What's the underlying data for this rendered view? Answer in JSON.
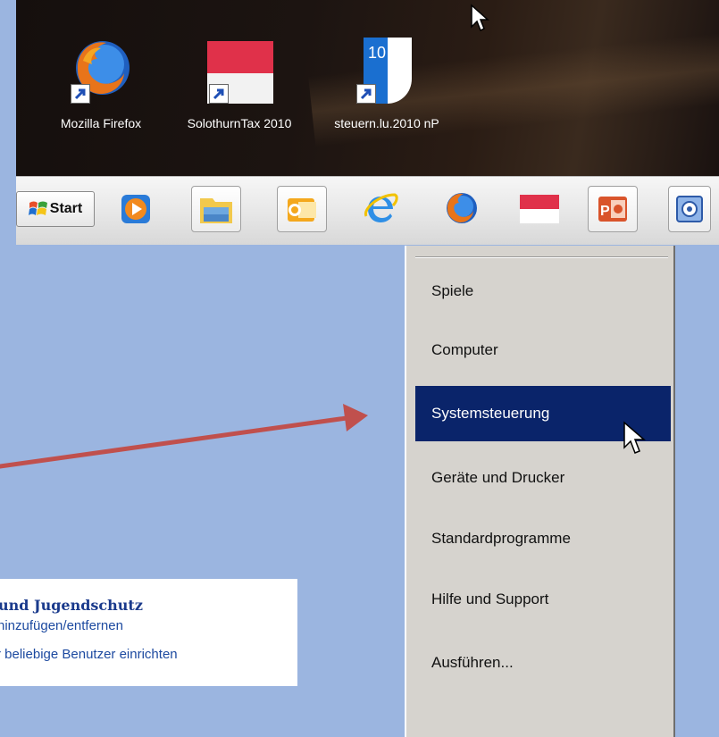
{
  "desktop": {
    "icons": [
      {
        "label": "Mozilla Firefox",
        "icon": "firefox-icon"
      },
      {
        "label": "SolothurnTax 2010",
        "icon": "solothurntax-icon"
      },
      {
        "label": "steuern.lu.2010 nP",
        "icon": "steuern-lu-icon",
        "badge": "10"
      }
    ]
  },
  "taskbar": {
    "start_label": "Start",
    "pinned": [
      "media-player-icon",
      "explorer-folder-icon",
      "outlook-icon",
      "internet-explorer-icon",
      "firefox-icon",
      "solothurntax-icon",
      "powerpoint-icon",
      "help-app-icon"
    ]
  },
  "start_menu": {
    "items": [
      {
        "label": "Spiele"
      },
      {
        "label": "Computer"
      },
      {
        "label": "Systemsteuerung",
        "selected": true
      },
      {
        "label": "Geräte und Drucker"
      },
      {
        "label": "Standardprogramme"
      },
      {
        "label": "Hilfe und Support"
      },
      {
        "label": "Ausführen..."
      }
    ],
    "selected_bg": "#0a246a"
  },
  "control_panel_snippet": {
    "title": "und Jugendschutz",
    "line1": "hinzufügen/entfernen",
    "line2": "r beliebige Benutzer einrichten"
  },
  "colors": {
    "background": "#9bb5e0",
    "arrow": "#c0504d"
  }
}
